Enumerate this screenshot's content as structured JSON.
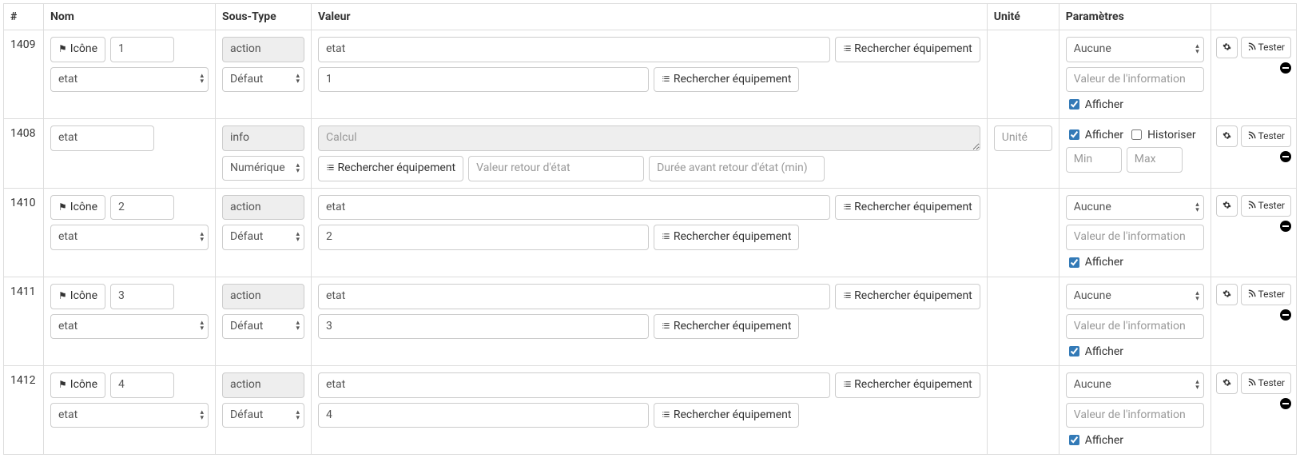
{
  "headers": {
    "id": "#",
    "nom": "Nom",
    "sous_type": "Sous-Type",
    "valeur": "Valeur",
    "unite": "Unité",
    "parametres": "Paramètres"
  },
  "labels": {
    "icone_btn": "Icône",
    "rechercher_eq": "Rechercher équipement",
    "tester": "Tester",
    "afficher": "Afficher",
    "historiser": "Historiser"
  },
  "placeholders": {
    "calcul": "Calcul",
    "valeur_retour": "Valeur retour d'état",
    "duree_retour": "Durée avant retour d'état (min)",
    "unite": "Unité",
    "valeur_info": "Valeur de l'information",
    "min": "Min",
    "max": "Max"
  },
  "options": {
    "etat": "etat",
    "defaut": "Défaut",
    "numerique": "Numérique",
    "aucune": "Aucune"
  },
  "rows": [
    {
      "kind": "action",
      "id": "1409",
      "nom_num": "1",
      "type_val": "action",
      "valeur1": "etat",
      "valeur2": "1"
    },
    {
      "kind": "info",
      "id": "1408",
      "nom_text": "etat",
      "type_val": "info"
    },
    {
      "kind": "action",
      "id": "1410",
      "nom_num": "2",
      "type_val": "action",
      "valeur1": "etat",
      "valeur2": "2"
    },
    {
      "kind": "action",
      "id": "1411",
      "nom_num": "3",
      "type_val": "action",
      "valeur1": "etat",
      "valeur2": "3"
    },
    {
      "kind": "action",
      "id": "1412",
      "nom_num": "4",
      "type_val": "action",
      "valeur1": "etat",
      "valeur2": "4"
    }
  ]
}
